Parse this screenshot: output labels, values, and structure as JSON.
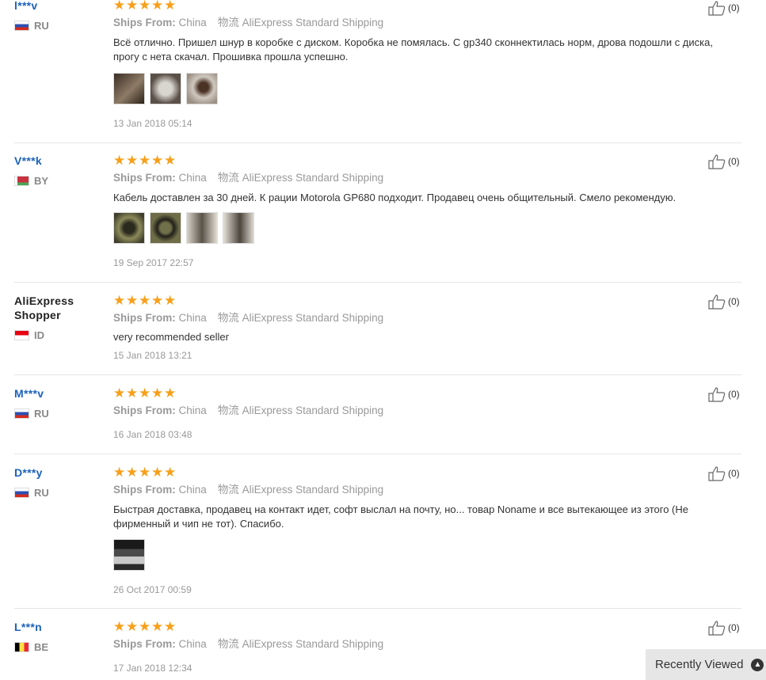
{
  "labels": {
    "ships_from": "Ships From:",
    "logistics": "物流",
    "helpful_prefix": "(",
    "recently_viewed": "Recently Viewed"
  },
  "reviews": [
    {
      "user": "l***v",
      "country": "RU",
      "flag": "ru",
      "ships_from": "China",
      "shipping": "AliExpress Standard Shipping",
      "text": "Всё отлично. Пришел шнур в коробке с диском. Коробка не помялась. С gp340 сконнектилась норм, дрова подошли с диска, прогу с нета скачал. Прошивка прошла успешно.",
      "photos": 3,
      "date": "13 Jan 2018 05:14",
      "helpful": "(0)"
    },
    {
      "user": "V***k",
      "country": "BY",
      "flag": "by",
      "ships_from": "China",
      "shipping": "AliExpress Standard Shipping",
      "text": "Кабель доставлен за 30 дней. К рации Motorola GP680 подходит. Продавец очень общительный. Смело рекомендую.",
      "photos": 4,
      "date": "19 Sep 2017 22:57",
      "helpful": "(0)"
    },
    {
      "user": "AliExpress Shopper",
      "country": "ID",
      "flag": "id",
      "ships_from": "China",
      "shipping": "AliExpress Standard Shipping",
      "text": "very recommended seller",
      "photos": 0,
      "date": "15 Jan 2018 13:21",
      "helpful": "(0)"
    },
    {
      "user": "M***v",
      "country": "RU",
      "flag": "ru",
      "ships_from": "China",
      "shipping": "AliExpress Standard Shipping",
      "text": "",
      "photos": 0,
      "date": "16 Jan 2018 03:48",
      "helpful": "(0)"
    },
    {
      "user": "D***y",
      "country": "RU",
      "flag": "ru",
      "ships_from": "China",
      "shipping": "AliExpress Standard Shipping",
      "text": "Быстрая доставка, продавец на контакт идет, софт выслал на почту, но... товар Noname и все вытекающее из этого (Не фирменный и чип не тот). Спасибо.",
      "photos": 1,
      "date": "26 Oct 2017 00:59",
      "helpful": "(0)"
    },
    {
      "user": "L***n",
      "country": "BE",
      "flag": "be",
      "ships_from": "China",
      "shipping": "AliExpress Standard Shipping",
      "text": "",
      "photos": 0,
      "date": "17 Jan 2018 12:34",
      "helpful": "(0)"
    }
  ],
  "colors": {
    "star": "#f7a01b",
    "username": "#1c62b9",
    "muted": "#999999"
  },
  "icons": {
    "like": "thumbs-up-icon",
    "rating": "star-icon",
    "recent_toggle": "chevron-up-icon"
  }
}
